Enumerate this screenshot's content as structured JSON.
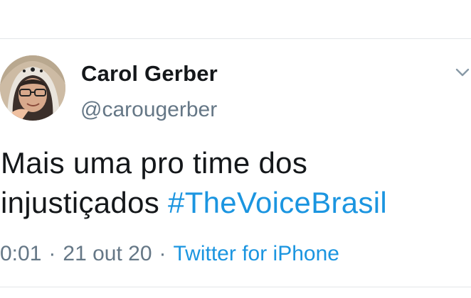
{
  "tweet": {
    "author_name": "Carol Gerber",
    "author_handle": "@carougerber",
    "text_line1": "Mais uma pro time dos",
    "text_line2_prefix": "injustiçados ",
    "hashtag": "#TheVoiceBrasil",
    "time": "0:01",
    "separator": "·",
    "date": "21 out 20",
    "source": "Twitter for iPhone"
  },
  "icons": {
    "avatar": "profile-photo",
    "caret": "chevron-down-icon"
  },
  "colors": {
    "link": "#1b95e0",
    "text": "#14171a",
    "secondary": "#657786"
  }
}
